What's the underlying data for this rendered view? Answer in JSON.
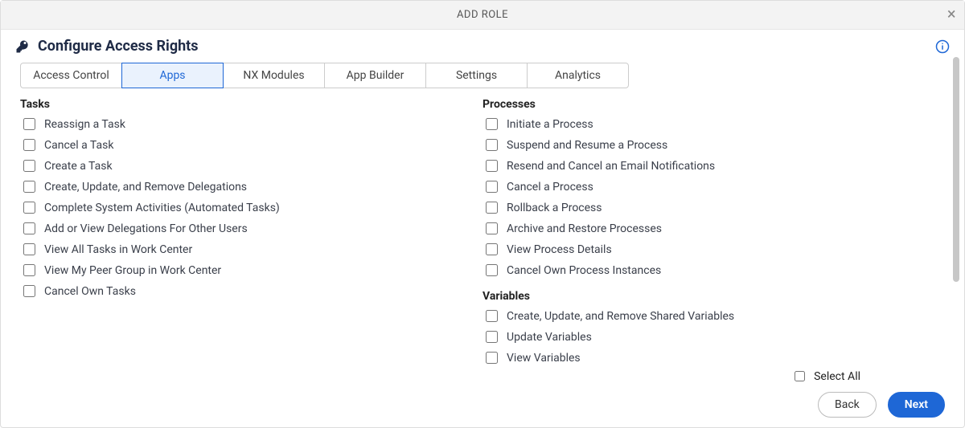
{
  "modal": {
    "title": "ADD ROLE",
    "subtitle": "Configure Access Rights"
  },
  "tabs": [
    {
      "label": "Access Control"
    },
    {
      "label": "Apps"
    },
    {
      "label": "NX Modules"
    },
    {
      "label": "App Builder"
    },
    {
      "label": "Settings"
    },
    {
      "label": "Analytics"
    }
  ],
  "activeTab": "Apps",
  "sections": {
    "tasks": {
      "title": "Tasks",
      "items": [
        "Reassign a Task",
        "Cancel a Task",
        "Create a Task",
        "Create, Update, and Remove Delegations",
        "Complete System Activities (Automated Tasks)",
        "Add or View Delegations For Other Users",
        "View All Tasks in Work Center",
        "View My Peer Group in Work Center",
        "Cancel Own Tasks"
      ]
    },
    "processes": {
      "title": "Processes",
      "items": [
        "Initiate a Process",
        "Suspend and Resume a Process",
        "Resend and Cancel an Email Notifications",
        "Cancel a Process",
        "Rollback a Process",
        "Archive and Restore Processes",
        "View Process Details",
        "Cancel Own Process Instances"
      ]
    },
    "variables": {
      "title": "Variables",
      "items": [
        "Create, Update, and Remove Shared Variables",
        "Update Variables",
        "View Variables"
      ]
    }
  },
  "footer": {
    "selectAll": "Select All",
    "back": "Back",
    "next": "Next"
  }
}
